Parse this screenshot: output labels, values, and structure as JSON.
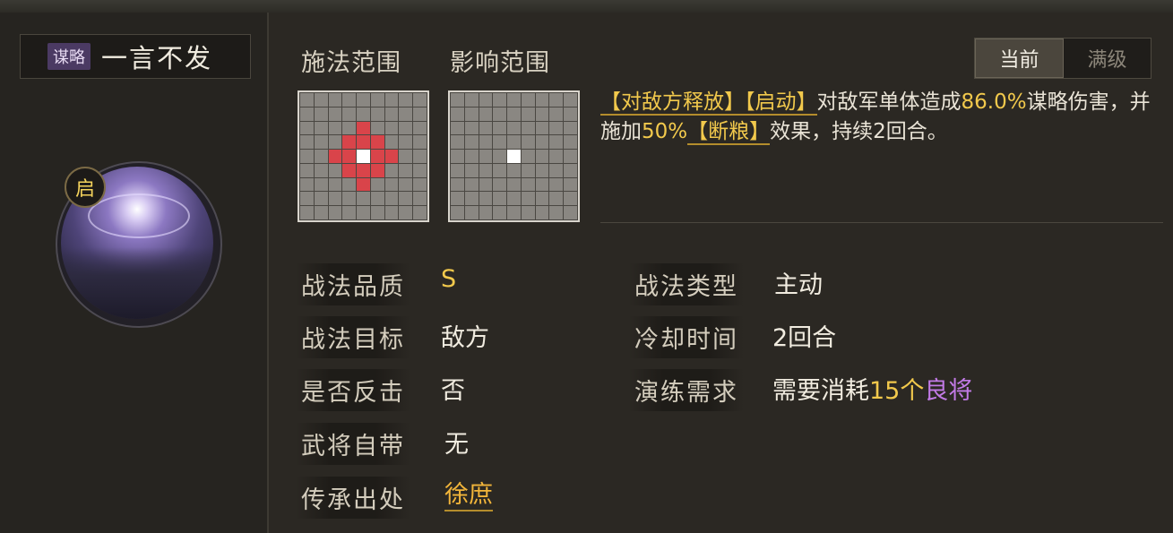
{
  "skill": {
    "type_tag": "谋略",
    "name": "一言不发",
    "activation_badge": "启"
  },
  "range": {
    "cast_title": "施法范围",
    "effect_title": "影响范围"
  },
  "tabs": [
    "当前",
    "满级"
  ],
  "active_tab": 0,
  "description": {
    "tag1": "【对敌方释放】",
    "tag2": "【启动】",
    "text1": "对敌军单体造成",
    "damage": "86.0%",
    "text2": "谋略伤害，并施加",
    "chance": "50%",
    "tag3": "【断粮】",
    "text3": "效果，持续2回合。"
  },
  "attributes": {
    "quality_label": "战法品质",
    "quality_value": "S",
    "target_label": "战法目标",
    "target_value": "敌方",
    "counter_label": "是否反击",
    "counter_value": "否",
    "innate_label": "武将自带",
    "innate_value": "无",
    "inherit_label": "传承出处",
    "inherit_value": "徐庶",
    "type_label": "战法类型",
    "type_value": "主动",
    "cooldown_label": "冷却时间",
    "cooldown_value": "2回合",
    "train_label": "演练需求",
    "train_text": "需要消耗",
    "train_count": "15个",
    "train_item": "良将"
  },
  "colors": {
    "gold": "#f2c94c",
    "purple": "#c27ae6",
    "red_cell": "#d9444a",
    "tag_purple": "#4b3a63"
  }
}
